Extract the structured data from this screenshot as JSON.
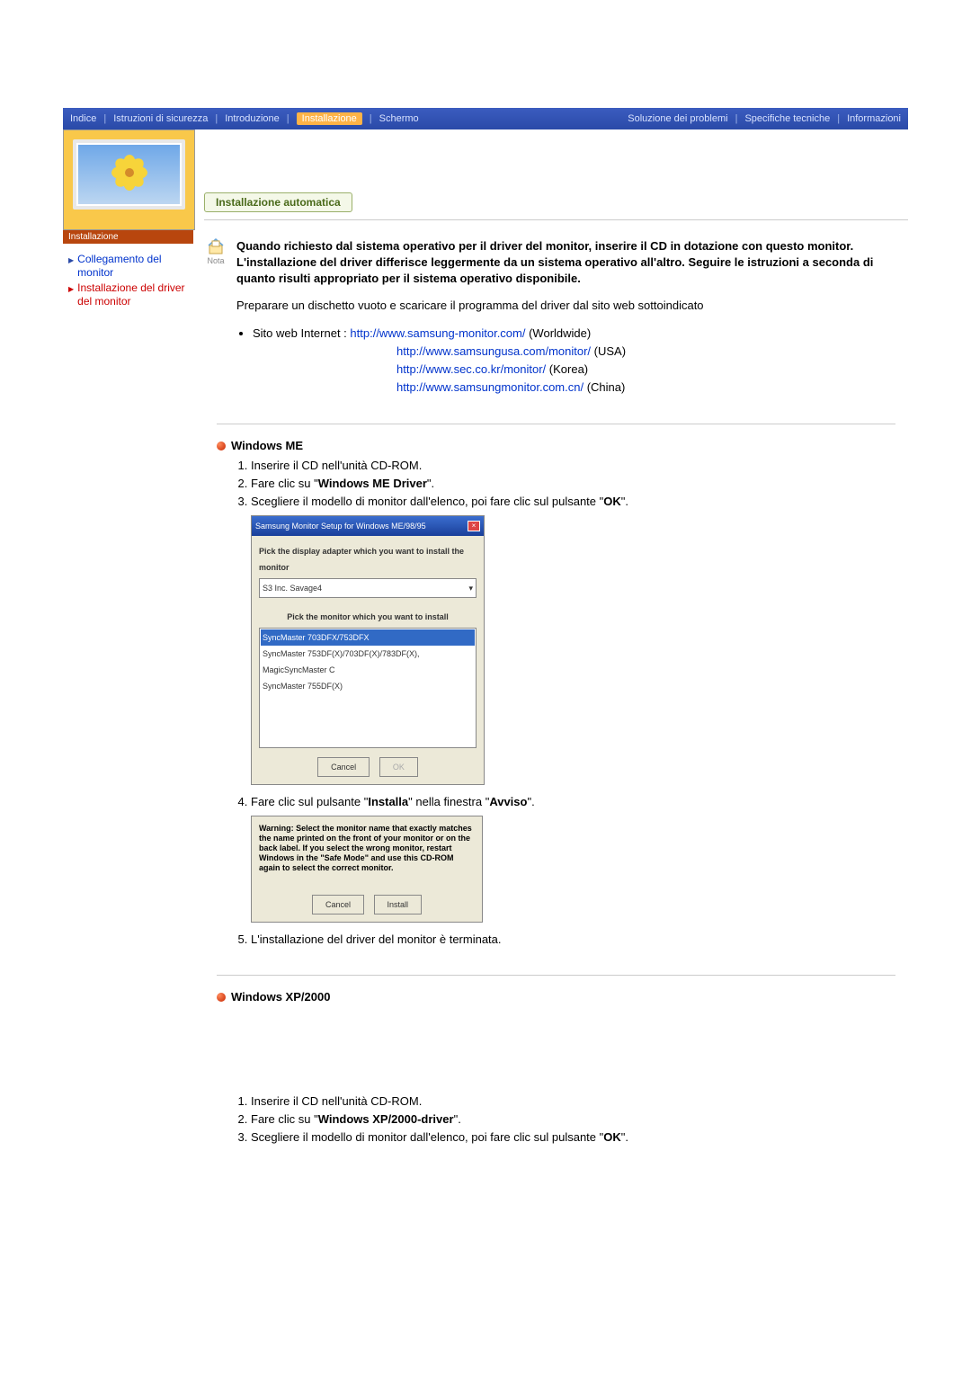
{
  "nav": {
    "items": [
      "Indice",
      "Istruzioni di sicurezza",
      "Introduzione",
      "Installazione",
      "Schermo",
      "Soluzione dei problemi",
      "Specifiche tecniche",
      "Informazioni"
    ],
    "active_index": 3
  },
  "sidebar": {
    "image_label": "Installazione",
    "links": [
      {
        "label": "Collegamento del monitor",
        "active": false
      },
      {
        "label": "Installazione del driver del monitor",
        "active": true
      }
    ]
  },
  "tab": {
    "label": "Installazione automatica"
  },
  "note": {
    "icon_label": "Nota",
    "text": "Quando richiesto dal sistema operativo per il driver del monitor, inserire il CD in dotazione con questo monitor. L'installazione del driver differisce leggermente da un sistema operativo all'altro. Seguire le istruzioni a seconda di quanto risulti appropriato per il sistema operativo disponibile."
  },
  "prep_text": "Preparare un dischetto vuoto e scaricare il programma del driver dal sito web sottoindicato",
  "sites": {
    "lead": "Sito web Internet :",
    "items": [
      {
        "url": "http://www.samsung-monitor.com/",
        "suffix": " (Worldwide)"
      },
      {
        "url": "http://www.samsungusa.com/monitor/",
        "suffix": " (USA)"
      },
      {
        "url": "http://www.sec.co.kr/monitor/",
        "suffix": " (Korea)"
      },
      {
        "url": "http://www.samsungmonitor.com.cn/",
        "suffix": " (China)"
      }
    ]
  },
  "section_me": {
    "title": "Windows ME",
    "step1": "Inserire il CD nell'unità CD-ROM.",
    "step2_pre": "Fare clic su \"",
    "step2_bold": "Windows ME Driver",
    "step2_post": "\".",
    "step3_pre": "Scegliere il modello di monitor dall'elenco, poi fare clic sul pulsante \"",
    "step3_bold": "OK",
    "step3_post": "\".",
    "step4_pre": "Fare clic sul pulsante \"",
    "step4_bold1": "Installa",
    "step4_mid": "\" nella finestra \"",
    "step4_bold2": "Avviso",
    "step4_post": "\".",
    "step5": "L'installazione del driver del monitor è terminata."
  },
  "dialog1": {
    "title": "Samsung Monitor Setup for Windows ME/98/95",
    "label1": "Pick the display adapter which you want to install the monitor",
    "adapter": "S3 Inc. Savage4",
    "label2": "Pick the monitor which you want to install",
    "list": [
      "SyncMaster 703DFX/753DFX",
      "SyncMaster 753DF(X)/703DF(X)/783DF(X), MagicSyncMaster C",
      "SyncMaster 755DF(X)"
    ],
    "cancel": "Cancel",
    "ok": "OK"
  },
  "dialog2": {
    "warning": "Warning: Select the monitor name that exactly matches the name printed on the front of your monitor or on the back label. If you select the wrong monitor, restart Windows in the \"Safe Mode\" and use this CD-ROM again to select the correct monitor.",
    "cancel": "Cancel",
    "install": "Install"
  },
  "section_xp": {
    "title": "Windows XP/2000",
    "step1": "Inserire il CD nell'unità CD-ROM.",
    "step2_pre": "Fare clic su \"",
    "step2_bold": "Windows XP/2000-driver",
    "step2_post": "\".",
    "step3_pre": "Scegliere il modello di monitor dall'elenco, poi fare clic sul pulsante \"",
    "step3_bold": "OK",
    "step3_post": "\"."
  }
}
